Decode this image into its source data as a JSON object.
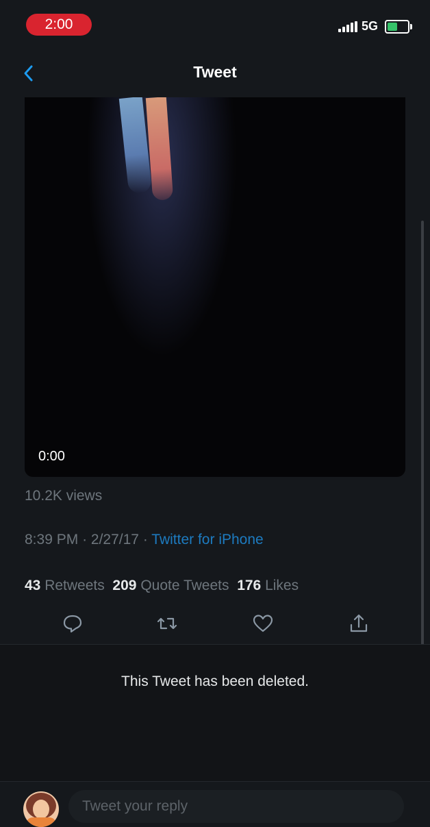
{
  "status_bar": {
    "time": "2:00",
    "network": "5G",
    "battery_color": "#36c36a"
  },
  "nav": {
    "title": "Tweet",
    "back_icon": "chevron-left-icon"
  },
  "video": {
    "time": "0:00"
  },
  "tweet": {
    "views": "10.2K views",
    "time": "8:39 PM",
    "date": "2/27/17",
    "separator": "·",
    "source": "Twitter for iPhone",
    "retweets_count": "43",
    "retweets_label": "Retweets",
    "quotes_count": "209",
    "quotes_label": "Quote Tweets",
    "likes_count": "176",
    "likes_label": "Likes"
  },
  "actions": [
    "reply-icon",
    "retweet-icon",
    "like-icon",
    "share-icon"
  ],
  "deleted_message": "This Tweet has been deleted.",
  "reply": {
    "placeholder": "Tweet your reply"
  },
  "colors": {
    "accent": "#1d7bc0",
    "recording_pill": "#d9242f"
  }
}
